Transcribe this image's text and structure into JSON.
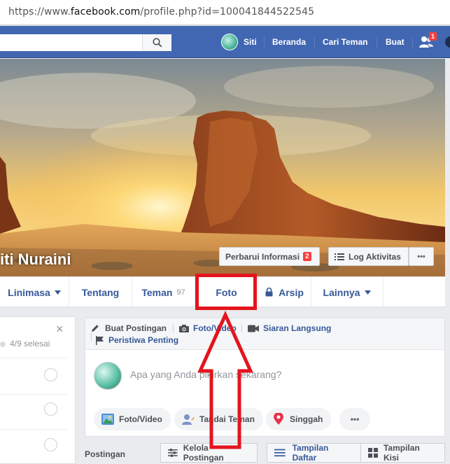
{
  "browser": {
    "url_prefix": "https://www.",
    "url_domain": "facebook.com",
    "url_suffix": "/profile.php?id=100041844522545"
  },
  "nav": {
    "user_name": "Siti",
    "home": "Beranda",
    "find_friends": "Cari Teman",
    "create": "Buat",
    "friend_requests_count": "1"
  },
  "profile": {
    "name": "iti Nuraini",
    "update_info": "Perbarui Informasi",
    "update_info_badge": "2",
    "activity_log": "Log Aktivitas",
    "more": "•••"
  },
  "tabs": [
    {
      "label": "Linimasa"
    },
    {
      "label": "Tentang"
    },
    {
      "label": "Teman",
      "count": "97"
    },
    {
      "label": "Foto"
    },
    {
      "label": "Arsip"
    },
    {
      "label": "Lainnya"
    }
  ],
  "left_card": {
    "progress": "4/9 selesai",
    "close": "×"
  },
  "composer": {
    "create_post": "Buat Postingan",
    "photo_video": "Foto/Video",
    "live_video": "Siaran Langsung",
    "life_event": "Peristiwa Penting",
    "placeholder": "Apa yang Anda pikirkan sekarang?",
    "chips": [
      "Foto/Video",
      "Tandai Teman",
      "Singgah"
    ],
    "more": "•••"
  },
  "posts_bar": {
    "label": "Postingan",
    "manage": "Kelola Postingan",
    "list_view": "Tampilan Daftar",
    "grid_view": "Tampilan Kisi"
  },
  "colors": {
    "fb_blue": "#4267b2",
    "link_blue": "#365899",
    "highlight_red": "#e4141d"
  }
}
